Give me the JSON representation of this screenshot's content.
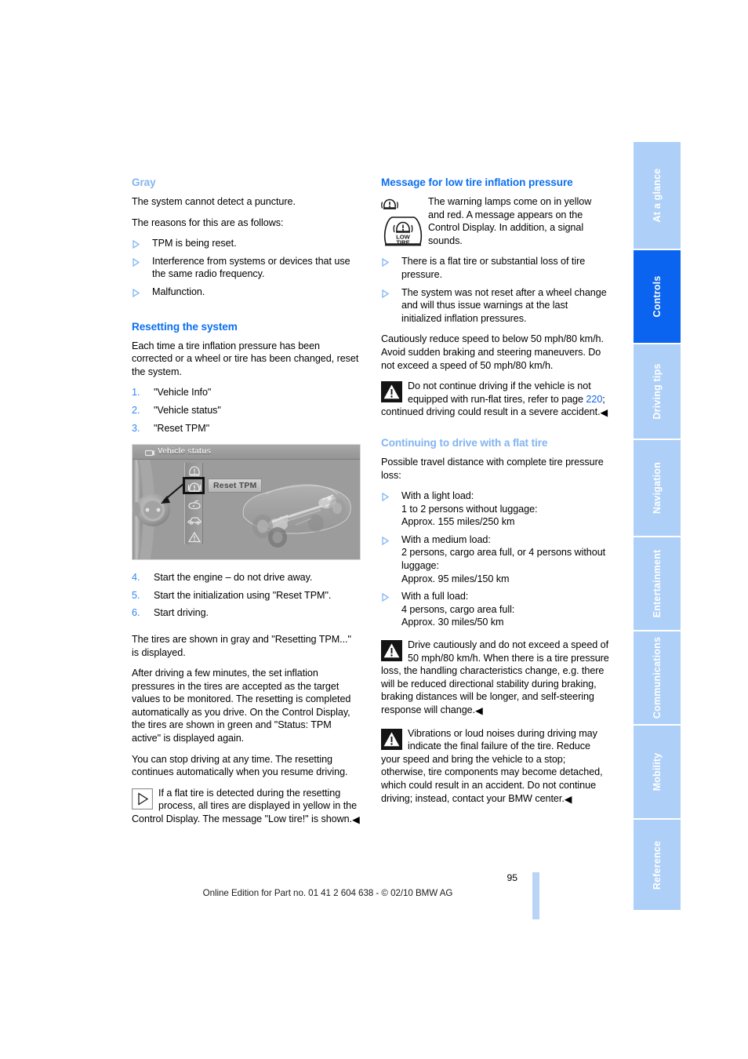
{
  "page": {
    "number": "95",
    "footer": "Online Edition for Part no. 01 41 2 604 638 - © 02/10 BMW AG",
    "accent_strong": "#0c6fef",
    "accent_light": "#82b4f0",
    "tab_active_bg": "#0a64f0",
    "tab_bg": "#aed0f8"
  },
  "sidebar": {
    "items": [
      {
        "label": "At a glance",
        "active": false
      },
      {
        "label": "Controls",
        "active": true
      },
      {
        "label": "Driving tips",
        "active": false
      },
      {
        "label": "Navigation",
        "active": false
      },
      {
        "label": "Entertainment",
        "active": false
      },
      {
        "label": "Communications",
        "active": false
      },
      {
        "label": "Mobility",
        "active": false
      },
      {
        "label": "Reference",
        "active": false
      }
    ]
  },
  "left_column": {
    "gray_heading": "Gray",
    "gray_p1": "The system cannot detect a puncture.",
    "gray_p2": "The reasons for this are as follows:",
    "gray_bullets": [
      "TPM is being reset.",
      "Interference from systems or devices that use the same radio frequency.",
      "Malfunction."
    ],
    "reset_heading": "Resetting the system",
    "reset_intro": "Each time a tire inflation pressure has been corrected or a wheel or tire has been changed, reset the system.",
    "reset_steps_a": [
      {
        "n": "1.",
        "text": "\"Vehicle Info\""
      },
      {
        "n": "2.",
        "text": "\"Vehicle status\""
      },
      {
        "n": "3.",
        "text": "\"Reset TPM\""
      }
    ],
    "figure": {
      "title": "Vehicle status",
      "title_icon": "car-display-icon",
      "selected_item_label": "Reset TPM",
      "knob_icon": "idrive-controller-knob",
      "strip_icons": [
        "tire-pressure-icon",
        "tire-pressure-reset-icon",
        "engine-oil-icon",
        "car-body-icon",
        "warning-triangle-icon"
      ],
      "car_icon": "transparent-chassis-illustration"
    },
    "reset_steps_b": [
      {
        "n": "4.",
        "text": "Start the engine – do not drive away."
      },
      {
        "n": "5.",
        "text": "Start the initialization using \"Reset TPM\"."
      },
      {
        "n": "6.",
        "text": "Start driving."
      }
    ],
    "after_p1": "The tires are shown in gray and \"Resetting TPM...\" is displayed.",
    "after_p2": "After driving a few minutes, the set inflation pressures in the tires are accepted as the target values to be monitored. The resetting is completed automatically as you drive. On the Control Display, the tires are shown in green and \"Status: TPM active\" is displayed again.",
    "after_p3": "You can stop driving at any time. The resetting continues automatically when you resume driving.",
    "note": {
      "icon": "note-triangle-icon",
      "text": "If a flat tire is detected during the resetting process, all tires are displayed in yellow in the Control Display. The message \"Low tire!\" is shown.",
      "endmark": "◀"
    }
  },
  "right_column": {
    "message_heading": "Message for low tire inflation pressure",
    "lamp_icons": [
      "tire-pressure-warning-lamp-small",
      "low-tire-warning-lamp"
    ],
    "lamp_labels": {
      "line1": "LOW",
      "line2": "TIRE"
    },
    "lamp_text": "The warning lamps come on in yellow and red. A message appears on the Control Display. In addition, a signal sounds.",
    "message_bullets": [
      "There is a flat tire or substantial loss of tire pressure.",
      "The system was not reset after a wheel change and will thus issue warnings at the last initialized inflation pressures."
    ],
    "reduce_speed": "Cautiously reduce speed to below 50 mph/80 km/h. Avoid sudden braking and steering maneuvers. Do not exceed a speed of 50 mph/80 km/h.",
    "warning_runflat": {
      "icon": "warning-triangle-icon",
      "text_before": "Do not continue driving if the vehicle is not equipped with run-flat tires, refer to page ",
      "page_ref": "220",
      "text_after": "; continued driving could result in a severe accident.",
      "endmark": "◀"
    },
    "continuing_heading": "Continuing to drive with a flat tire",
    "continuing_intro": "Possible travel distance with complete tire pressure loss:",
    "load_cases": [
      {
        "title": "With a light load:",
        "detail": "1 to 2 persons without luggage:",
        "distance": "Approx. 155 miles/250 km"
      },
      {
        "title": "With a medium load:",
        "detail": "2 persons, cargo area full, or 4 persons without luggage:",
        "distance": "Approx. 95 miles/150 km"
      },
      {
        "title": "With a full load:",
        "detail": "4 persons, cargo area full:",
        "distance": "Approx. 30 miles/50 km"
      }
    ],
    "warning_drive": {
      "icon": "warning-triangle-icon",
      "text": "Drive cautiously and do not exceed a speed of 50 mph/80 km/h. When there is a tire pressure loss, the handling characteristics change, e.g. there will be reduced directional stability during braking, braking distances will be longer, and self-steering response will change.",
      "endmark": "◀"
    },
    "warning_vibration": {
      "icon": "warning-triangle-icon",
      "text": "Vibrations or loud noises during driving may indicate the final failure of the tire. Reduce your speed and bring the vehicle to a stop; otherwise, tire components may become detached, which could result in an accident. Do not continue driving; instead, contact your BMW center.",
      "endmark": "◀"
    }
  }
}
